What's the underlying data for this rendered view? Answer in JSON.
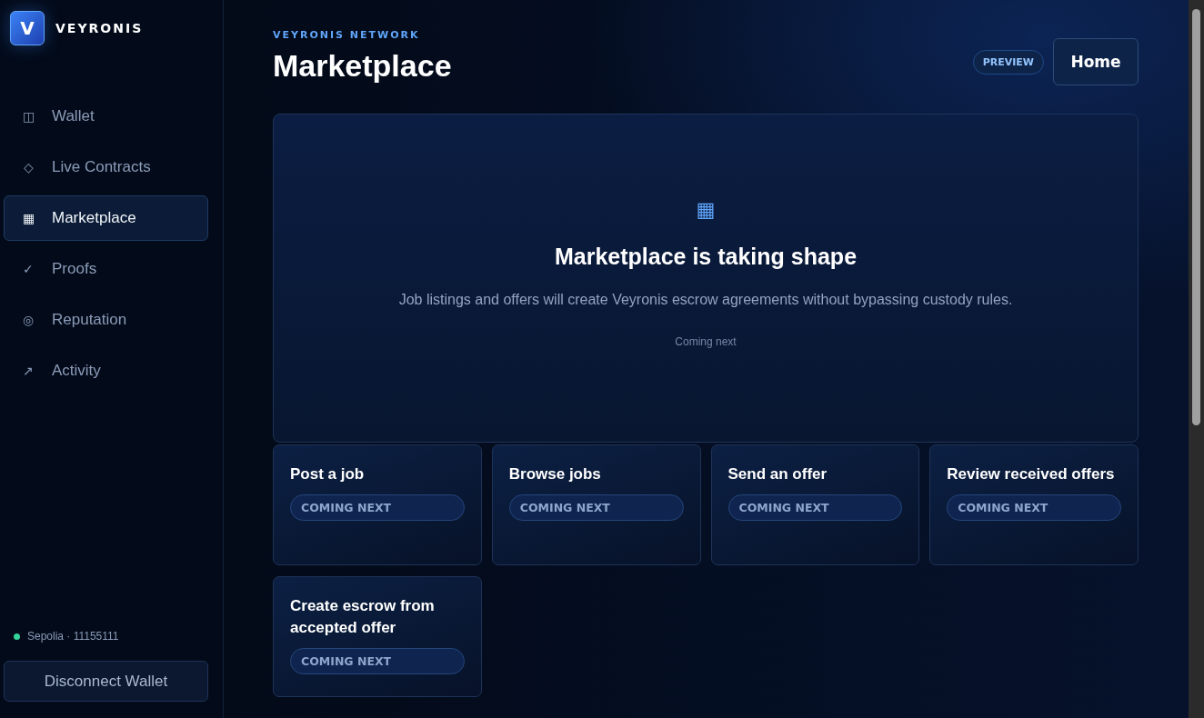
{
  "brand": {
    "logo": "V",
    "name": "VEYRONIS"
  },
  "nav": [
    {
      "icon": "◫",
      "label": "Wallet",
      "selected": false
    },
    {
      "icon": "◇",
      "label": "Live Contracts",
      "selected": false
    },
    {
      "icon": "▦",
      "label": "Marketplace",
      "selected": true
    },
    {
      "icon": "✓",
      "label": "Proofs",
      "selected": false
    },
    {
      "icon": "◎",
      "label": "Reputation",
      "selected": false
    },
    {
      "icon": "↗",
      "label": "Activity",
      "selected": false
    }
  ],
  "network": {
    "label": "Sepolia · 11155111",
    "color": "#34d399"
  },
  "disconnect_button": "Disconnect Wallet",
  "header": {
    "eyebrow": "VEYRONIS NETWORK",
    "title": "Marketplace",
    "badge": "PREVIEW",
    "home_button": "Home"
  },
  "hero": {
    "icon": "▦",
    "title": "Marketplace is taking shape",
    "text": "Job listings and offers will create Veyronis escrow agreements without bypassing custody rules.",
    "note": "Coming next"
  },
  "cards": [
    {
      "title": "Post a job",
      "status": "COMING NEXT"
    },
    {
      "title": "Browse jobs",
      "status": "COMING NEXT"
    },
    {
      "title": "Send an offer",
      "status": "COMING NEXT"
    },
    {
      "title": "Review received offers",
      "status": "COMING NEXT"
    },
    {
      "title": "Create escrow from accepted offer",
      "status": "COMING NEXT"
    }
  ]
}
